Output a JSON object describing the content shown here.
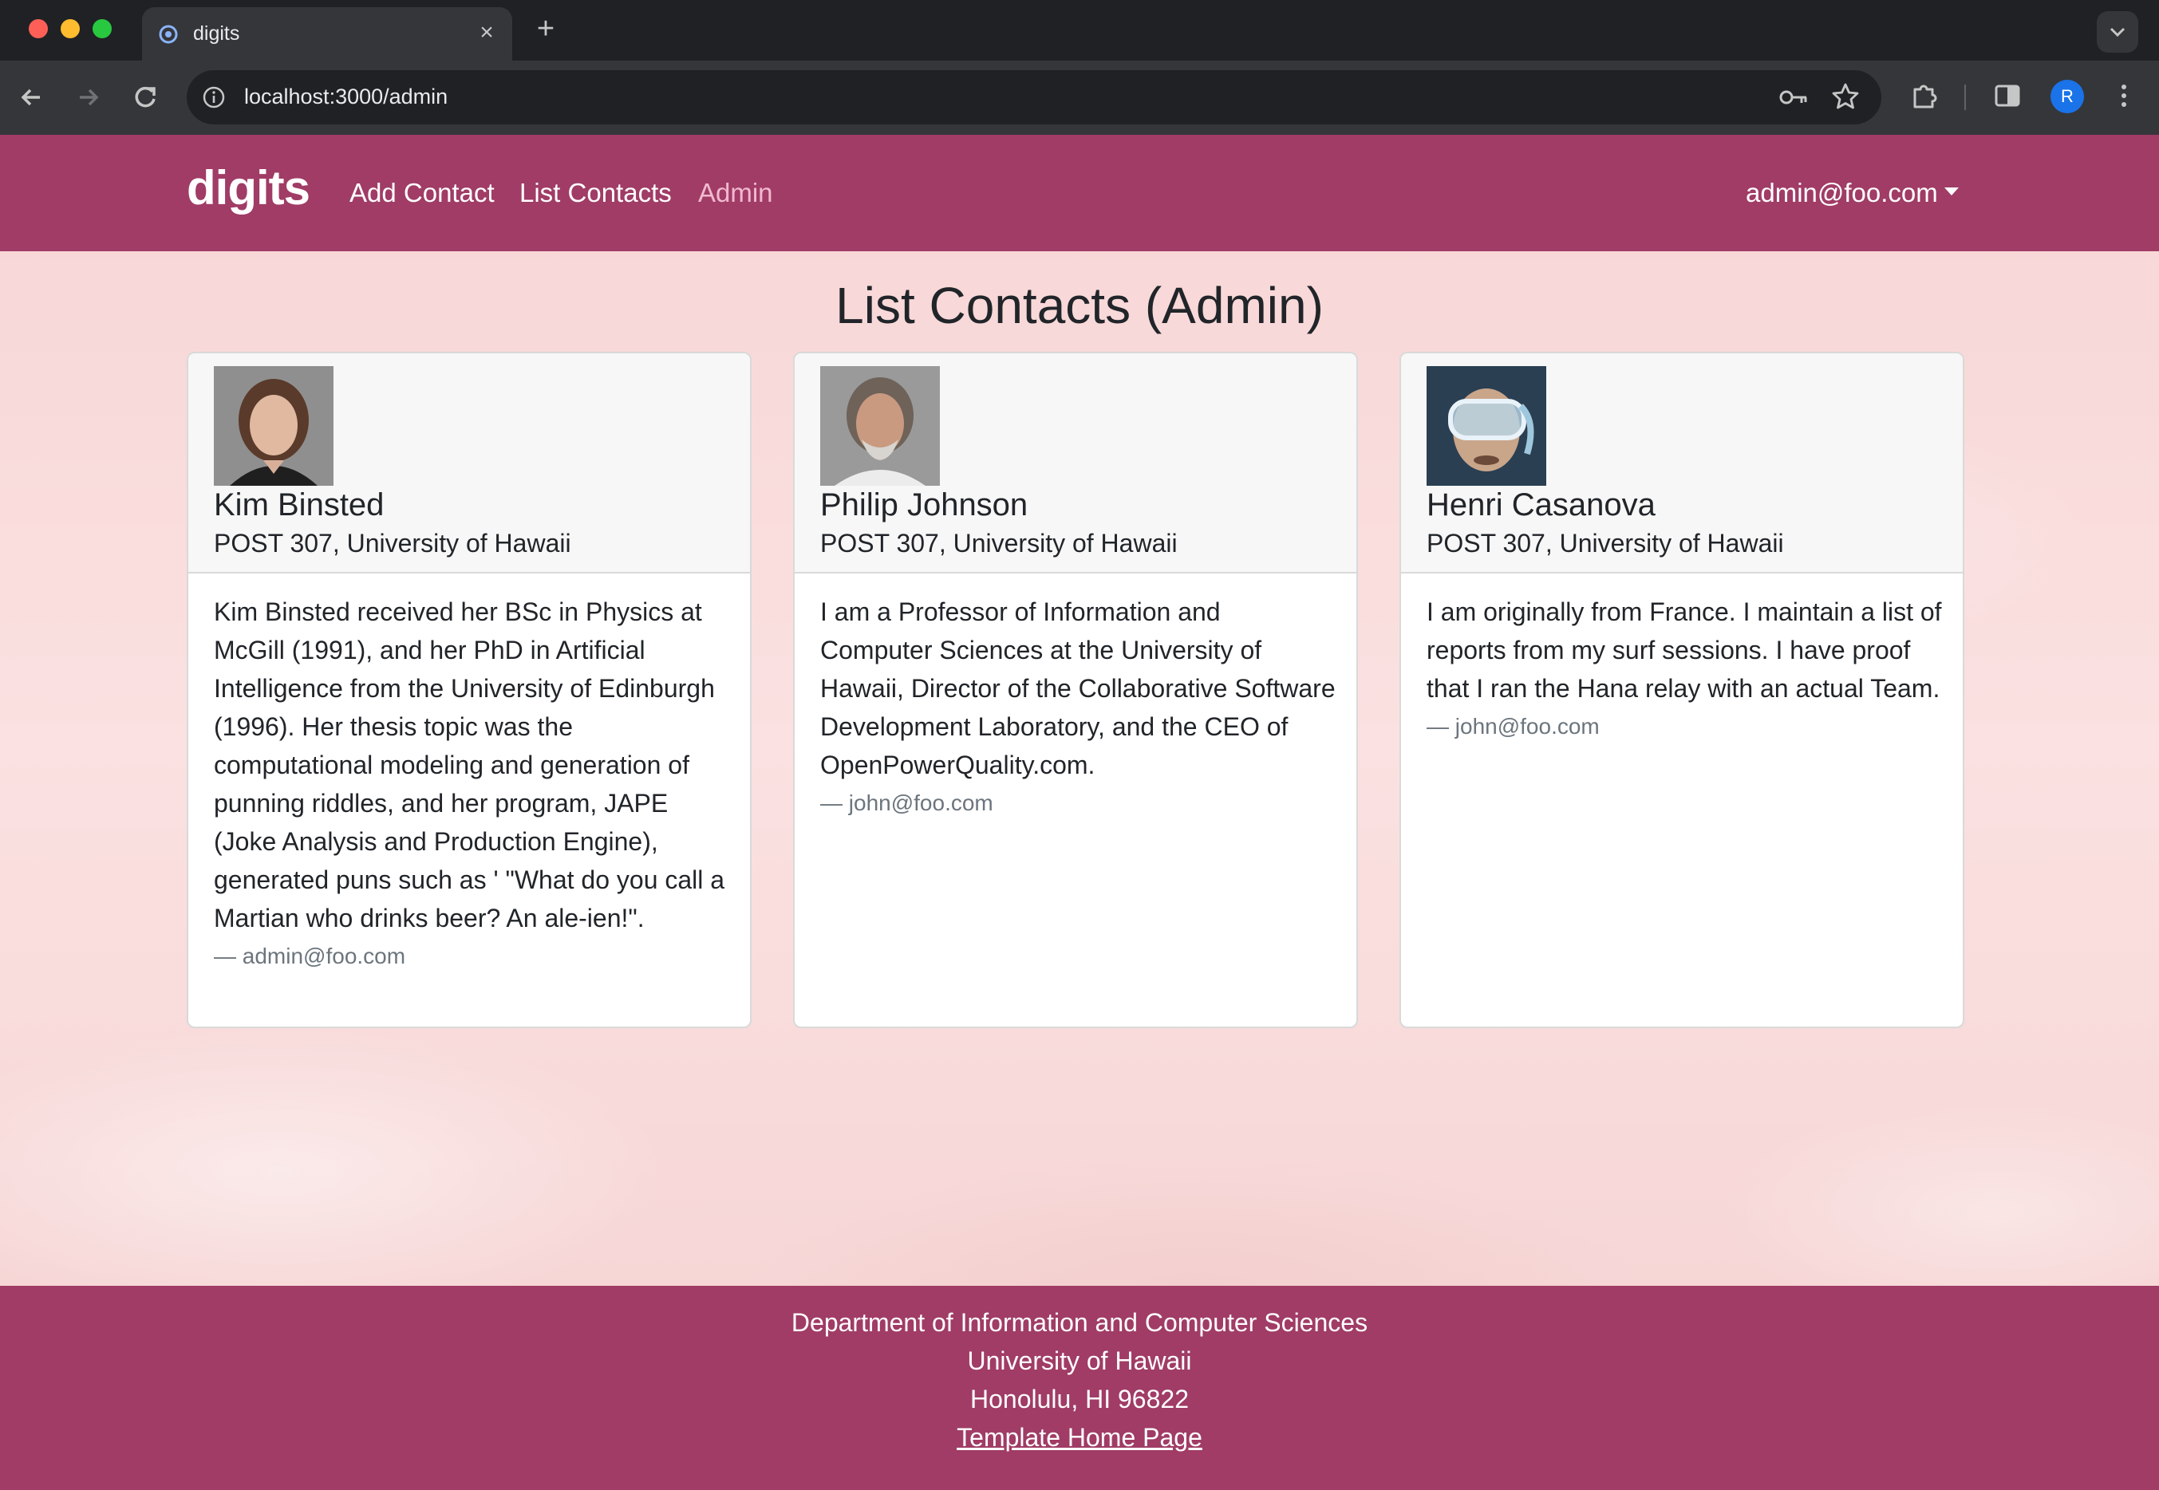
{
  "browser": {
    "tab_title": "digits",
    "url": "localhost:3000/admin",
    "profile_initial": "R"
  },
  "navbar": {
    "brand": "digits",
    "links": [
      "Add Contact",
      "List Contacts",
      "Admin"
    ],
    "active_link": "Admin",
    "user": "admin@foo.com"
  },
  "page": {
    "title": "List Contacts (Admin)"
  },
  "contacts": [
    {
      "name": "Kim Binsted",
      "address": "POST 307, University of Hawaii",
      "description": "Kim Binsted received her BSc in Physics at McGill (1991), and her PhD in Artificial Intelligence from the University of Edinburgh (1996). Her thesis topic was the computational modeling and generation of punning riddles, and her program, JAPE (Joke Analysis and Production Engine), generated puns such as ' \"What do you call a Martian who drinks beer? An ale-ien!\".",
      "owner": "— admin@foo.com"
    },
    {
      "name": "Philip Johnson",
      "address": "POST 307, University of Hawaii",
      "description": "I am a Professor of Information and Computer Sciences at the University of Hawaii, Director of the Collaborative Software Development Laboratory, and the CEO of OpenPowerQuality.com.",
      "owner": "— john@foo.com"
    },
    {
      "name": "Henri Casanova",
      "address": "POST 307, University of Hawaii",
      "description": "I am originally from France. I maintain a list of reports from my surf sessions. I have proof that I ran the Hana relay with an actual Team.",
      "owner": "— john@foo.com"
    }
  ],
  "footer": {
    "line1": "Department of Information and Computer Sciences",
    "line2": "University of Hawaii",
    "line3": "Honolulu, HI 96822",
    "link": "Template Home Page"
  },
  "colors": {
    "navbar": "#a03c66",
    "active_link": "#f2b8cf",
    "page_bg": "#f6dada"
  }
}
